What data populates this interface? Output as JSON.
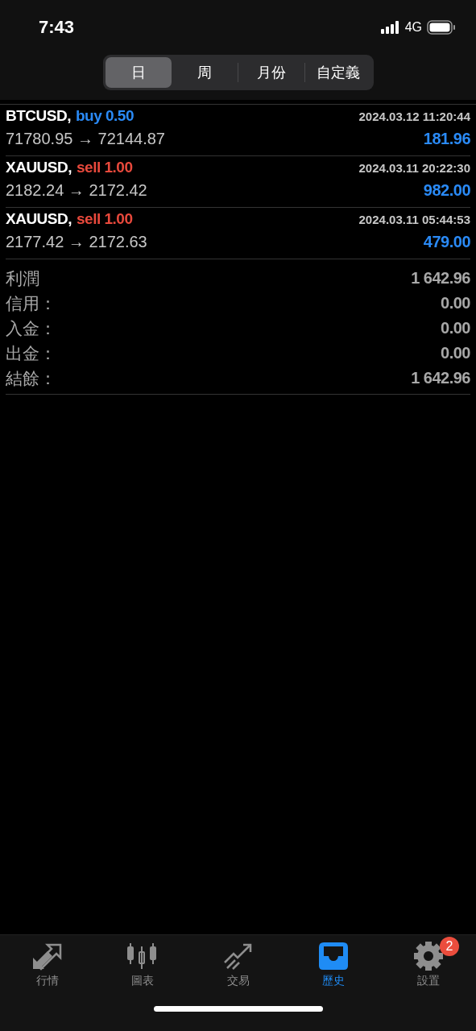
{
  "status_bar": {
    "time": "7:43",
    "network": "4G"
  },
  "tabs": [
    {
      "label": "日",
      "selected": true
    },
    {
      "label": "周",
      "selected": false
    },
    {
      "label": "月份",
      "selected": false
    },
    {
      "label": "自定義",
      "selected": false
    }
  ],
  "deals": [
    {
      "symbol": "BTCUSD,",
      "kind": "buy",
      "action": "buy 0.50",
      "time": "2024.03.12 11:20:44",
      "prices": "71780.95 → 72144.87",
      "profit": "181.96"
    },
    {
      "symbol": "XAUUSD,",
      "kind": "sell",
      "action": "sell 1.00",
      "time": "2024.03.11 20:22:30",
      "prices": "2182.24 → 2172.42",
      "profit": "982.00"
    },
    {
      "symbol": "XAUUSD,",
      "kind": "sell",
      "action": "sell 1.00",
      "time": "2024.03.11 05:44:53",
      "prices": "2177.42 → 2172.63",
      "profit": "479.00"
    }
  ],
  "summary": [
    {
      "label": "利潤",
      "value": "1 642.96"
    },
    {
      "label": "信用：",
      "value": "0.00"
    },
    {
      "label": "入金：",
      "value": "0.00"
    },
    {
      "label": "出金：",
      "value": "0.00"
    },
    {
      "label": "結餘：",
      "value": "1 642.96"
    }
  ],
  "nav": [
    {
      "kind": "quotes",
      "label": "行情",
      "selected": false
    },
    {
      "kind": "chart",
      "label": "圖表",
      "selected": false
    },
    {
      "kind": "trade",
      "label": "交易",
      "selected": false
    },
    {
      "kind": "history",
      "label": "歷史",
      "selected": true
    },
    {
      "kind": "settings",
      "label": "設置",
      "selected": false,
      "badge": "2"
    }
  ]
}
